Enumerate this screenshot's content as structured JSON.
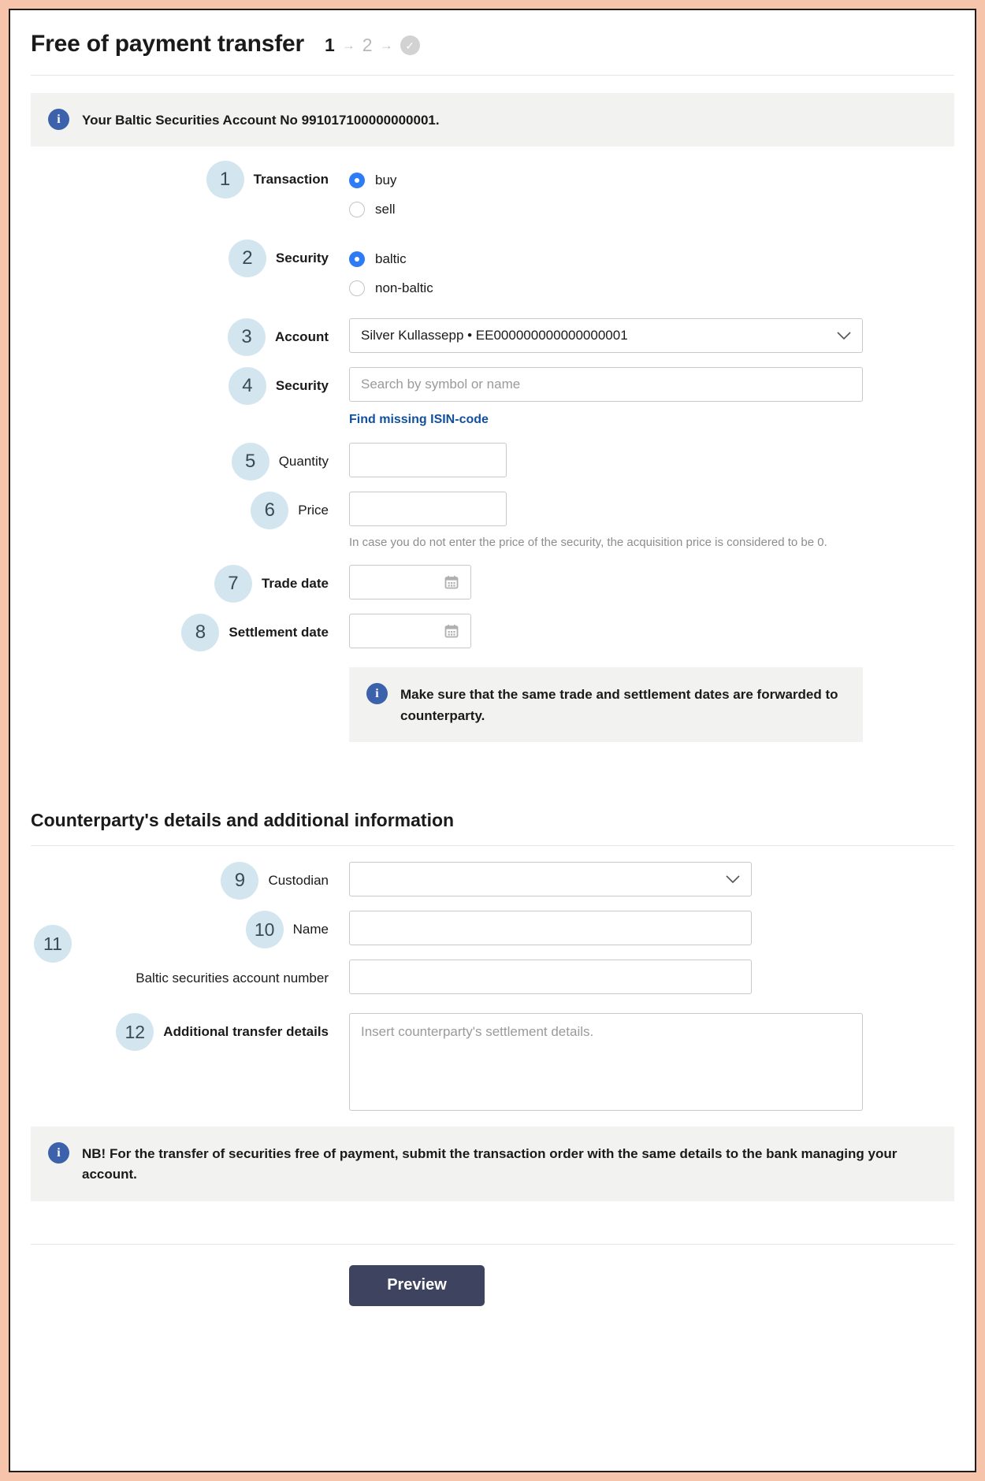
{
  "header": {
    "title": "Free of payment transfer",
    "steps": {
      "current": "1",
      "next": "2",
      "arrow": "→",
      "check": "✓"
    }
  },
  "top_notice": {
    "icon": "info-icon",
    "text": "Your Baltic Securities Account No 991017100000000001."
  },
  "form": {
    "transaction": {
      "number": "1",
      "label": "Transaction",
      "options": [
        {
          "label": "buy",
          "selected": true
        },
        {
          "label": "sell",
          "selected": false
        }
      ]
    },
    "security_type": {
      "number": "2",
      "label": "Security",
      "options": [
        {
          "label": "baltic",
          "selected": true
        },
        {
          "label": "non-baltic",
          "selected": false
        }
      ]
    },
    "account": {
      "number": "3",
      "label": "Account",
      "value": "Silver Kullassepp • EE000000000000000001",
      "chevron": "⌄"
    },
    "security": {
      "number": "4",
      "label": "Security",
      "placeholder": "Search by symbol or name",
      "value": "",
      "link": "Find missing ISIN-code"
    },
    "quantity": {
      "number": "5",
      "label": "Quantity",
      "value": "",
      "placeholder": ""
    },
    "price": {
      "number": "6",
      "label": "Price",
      "value": "",
      "placeholder": "",
      "hint": "In case you do not enter the price of the security, the acquisition price is considered to be 0."
    },
    "trade_date": {
      "number": "7",
      "label": "Trade date",
      "value": "",
      "placeholder": ""
    },
    "settlement_date": {
      "number": "8",
      "label": "Settlement date",
      "value": "",
      "placeholder": ""
    },
    "dates_notice": {
      "icon": "info-icon",
      "text": "Make sure that the same trade and settlement dates are forwarded to counterparty."
    }
  },
  "counterparty": {
    "section_title": "Counterparty's details and additional information",
    "custodian": {
      "number": "9",
      "label": "Custodian",
      "value": "",
      "chevron": "⌄"
    },
    "name": {
      "number": "10",
      "label": "Name",
      "value": "",
      "placeholder": ""
    },
    "baltic_account": {
      "number": "11",
      "label": "Baltic securities account number",
      "value": "",
      "placeholder": ""
    },
    "additional_details": {
      "number": "12",
      "label": "Additional transfer details",
      "placeholder": "Insert counterparty's settlement details.",
      "value": ""
    }
  },
  "bottom_notice": {
    "icon": "info-icon",
    "text": "NB! For the transfer of securities free of payment, submit the transaction order with the same details to the bank managing your account."
  },
  "footer": {
    "preview_label": "Preview"
  },
  "colors": {
    "outer_border": "#f6c3ab",
    "accent_blue": "#2e7bf6",
    "info_blue": "#3c62ac",
    "bubble_bg": "#d3e6ef",
    "link_blue": "#12509e",
    "button_bg": "#3e445f",
    "banner_bg": "#f2f2f0"
  }
}
